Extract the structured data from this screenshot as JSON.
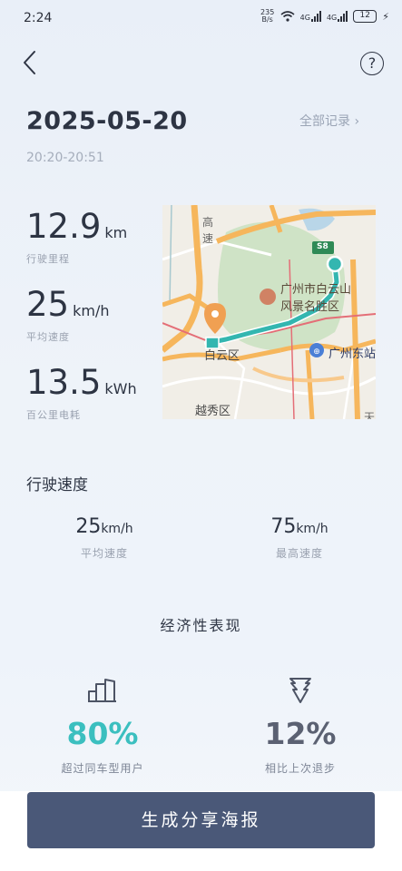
{
  "status_bar": {
    "time": "2:24",
    "net_speed_top": "235",
    "net_speed_bottom": "B/s",
    "signal1": "4G",
    "signal2": "4G",
    "battery": "12"
  },
  "header": {
    "date": "2025-05-20",
    "all_records": "全部记录 ›",
    "time_range": "20:20-20:51"
  },
  "stats": [
    {
      "value": "12.9",
      "unit": "km",
      "label": "行驶里程"
    },
    {
      "value": "25",
      "unit": "km/h",
      "label": "平均速度"
    },
    {
      "value": "13.5",
      "unit": "kWh",
      "label": "百公里电耗"
    }
  ],
  "map": {
    "labels": {
      "road_gao": "高",
      "road_su": "速",
      "area_baiyun_scenic": "广州市白云山",
      "area_baiyun_scenic2": "风景名胜区",
      "station": "广州东站",
      "district_baiyun": "白云区",
      "district_yuexiu": "越秀区",
      "highway_badge": "S8",
      "edge_tian": "天"
    },
    "colors": {
      "route": "#33b6b0",
      "green_area": "#cde3c4",
      "major_road": "#f5b35a",
      "start_pin": "#f0a052",
      "station_pin": "#4a7fd6"
    }
  },
  "speed_section": {
    "title": "行驶速度",
    "avg": {
      "value": "25",
      "unit": "km/h",
      "label": "平均速度"
    },
    "max": {
      "value": "75",
      "unit": "km/h",
      "label": "最高速度"
    }
  },
  "economy": {
    "title": "经济性表现",
    "left": {
      "value": "80%",
      "label": "超过同车型用户",
      "color": "#3bbfbf",
      "icon": "bar-chart-icon"
    },
    "right": {
      "value": "12%",
      "label": "相比上次退步",
      "color": "#5b6172",
      "icon": "arrow-down-icon"
    }
  },
  "cta": {
    "label": "生成分享海报"
  }
}
